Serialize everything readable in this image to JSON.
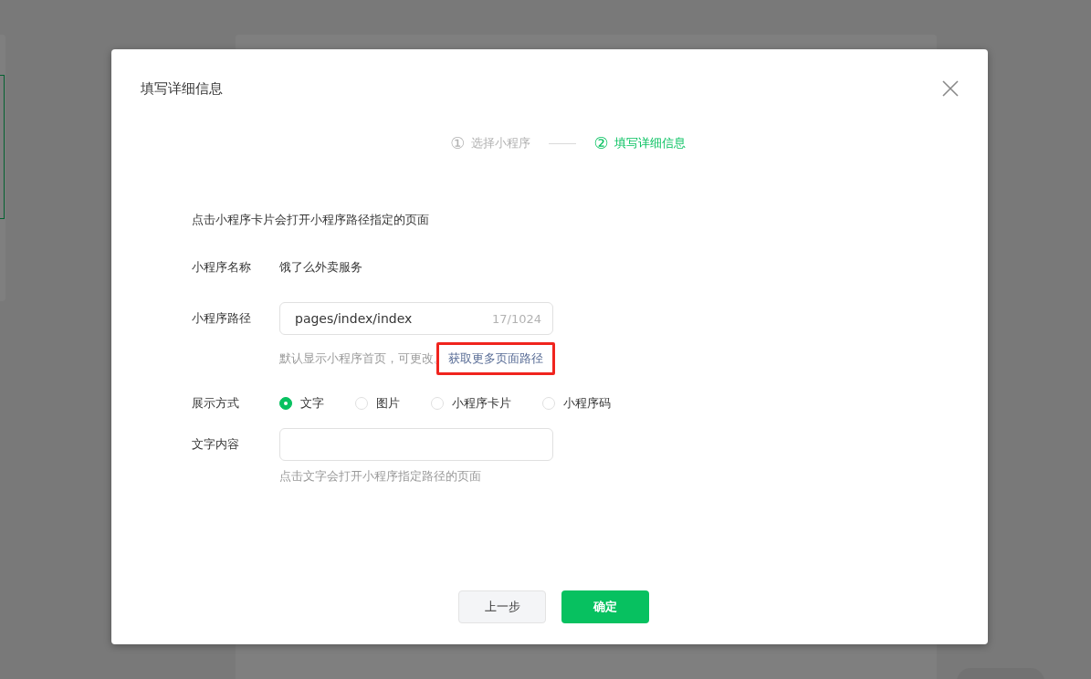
{
  "dialog": {
    "title": "填写详细信息"
  },
  "steps": [
    {
      "number": "①",
      "label": "选择小程序",
      "selected": false
    },
    {
      "number": "②",
      "label": "填写详细信息",
      "selected": true
    }
  ],
  "intro": "点击小程序卡片会打开小程序路径指定的页面",
  "fields": [
    {
      "kind": "static",
      "label": "小程序名称",
      "value": "饿了么外卖服务"
    },
    {
      "kind": "input",
      "label": "小程序路径",
      "value": "pages/index/index",
      "counter": "17/1024",
      "hint": "默认显示小程序首页，可更改。",
      "link": {
        "text": "获取更多页面路径",
        "highlighted": true
      }
    },
    {
      "kind": "radio",
      "label": "展示方式",
      "options": [
        {
          "label": "文字",
          "selected": true
        },
        {
          "label": "图片",
          "selected": false
        },
        {
          "label": "小程序卡片",
          "selected": false
        },
        {
          "label": "小程序码",
          "selected": false
        }
      ]
    },
    {
      "kind": "input",
      "label": "文字内容",
      "hint": "点击文字会打开小程序指定路径的页面"
    }
  ],
  "buttons": [
    {
      "kind": "secondary",
      "label": "上一步"
    },
    {
      "kind": "primary",
      "label": "确定"
    }
  ]
}
